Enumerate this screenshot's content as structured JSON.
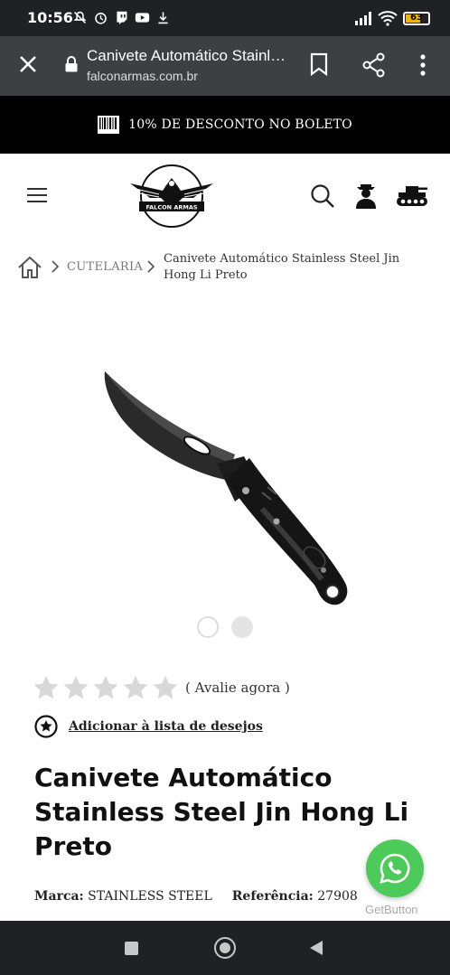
{
  "status_bar": {
    "time": "10:56",
    "battery": "63",
    "icons": [
      "mute-icon",
      "alarm-icon",
      "twitch-icon",
      "youtube-icon",
      "download-icon",
      "signal-icon",
      "wifi-icon",
      "battery-icon"
    ]
  },
  "browser": {
    "page_title": "Canivete Automático Stainless Steel Jin Hong Li Preto",
    "domain": "falconarmas.com.br"
  },
  "promo": {
    "text": "10% DE DESCONTO NO BOLETO"
  },
  "header": {
    "brand": "FALCON ARMAS"
  },
  "breadcrumb": {
    "category": "CUTELARIA",
    "current": "Canivete Automático Stainless Steel Jin Hong Li Preto"
  },
  "gallery": {
    "slide_count": 2,
    "active_slide": 1
  },
  "rating": {
    "stars": 0,
    "max": 5,
    "label": "( Avalie agora )"
  },
  "wishlist": {
    "label": "Adicionar à lista de desejos"
  },
  "product": {
    "title": "Canivete Automático Stainless Steel Jin Hong Li Preto",
    "brand_label": "Marca:",
    "brand_value": "STAINLESS STEEL",
    "ref_label": "Referência:",
    "ref_value": "27908"
  },
  "whatsapp": {
    "caption": "GetButton",
    "color": "#4cca5a"
  },
  "colors": {
    "promo_bg": "#000000",
    "browser_bg": "#3c4043",
    "status_bg": "#202124"
  }
}
